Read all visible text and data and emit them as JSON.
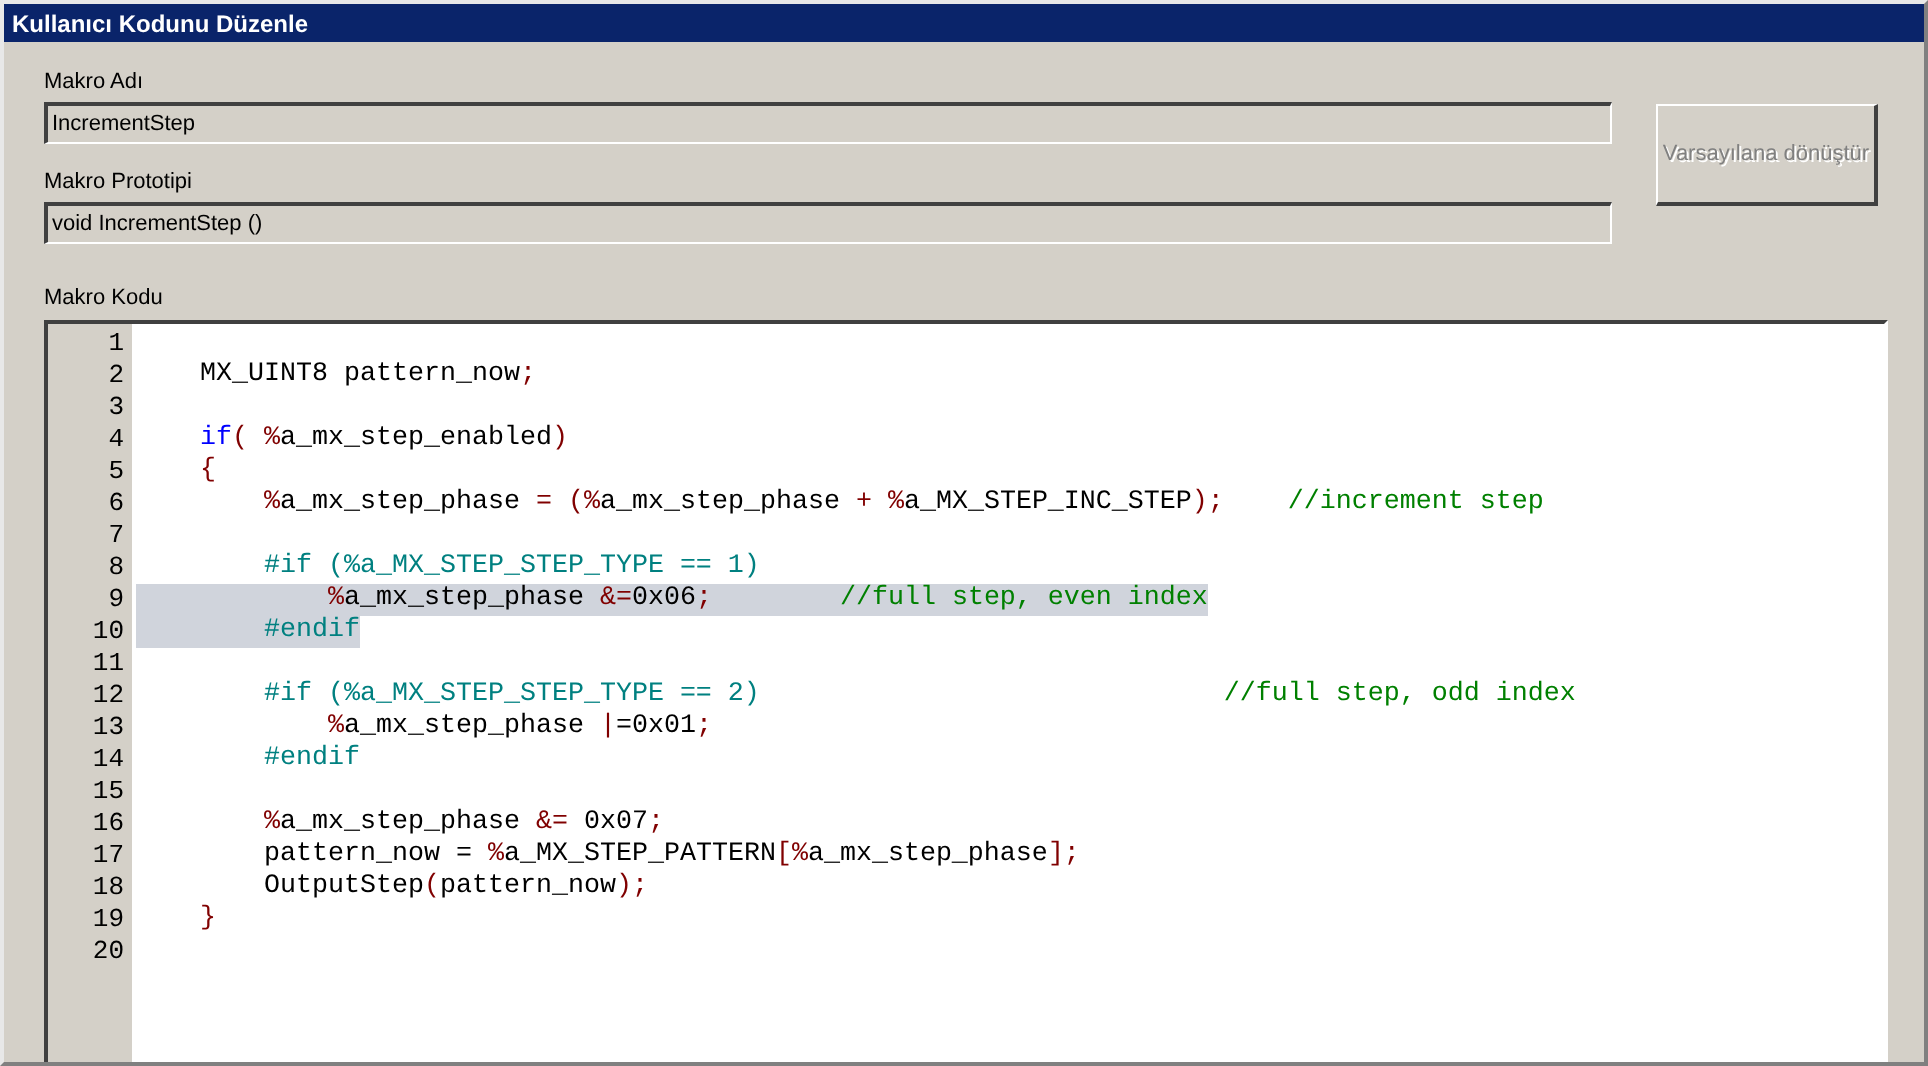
{
  "window": {
    "title": "Kullanıcı Kodunu Düzenle"
  },
  "fields": [
    {
      "label": "Makro Adı",
      "value": "IncrementStep"
    },
    {
      "label": "Makro Prototipi",
      "value": "void IncrementStep ()"
    }
  ],
  "button": {
    "label": "Varsayılana dönüştür",
    "disabled": true
  },
  "code": {
    "label": "Makro Kodu",
    "lines": [
      {
        "number": "1",
        "selected": false
      },
      {
        "number": "2",
        "selected": false,
        "segments": [
          {
            "text": "    MX_UINT8 pattern_now",
            "kind": "plain"
          },
          {
            "text": ";",
            "kind": "operator"
          }
        ]
      },
      {
        "number": "3",
        "selected": false
      },
      {
        "number": "4",
        "selected": false,
        "segments": [
          {
            "text": "    if",
            "kind": "keyword"
          },
          {
            "text": "( %",
            "kind": "operator"
          },
          {
            "text": "a_mx_step_enabled",
            "kind": "plain"
          },
          {
            "text": ")",
            "kind": "operator"
          }
        ]
      },
      {
        "number": "5",
        "selected": false,
        "segments": [
          {
            "text": "    {",
            "kind": "operator"
          }
        ]
      },
      {
        "number": "6",
        "selected": false,
        "segments": [
          {
            "text": "        %",
            "kind": "operator"
          },
          {
            "text": "a_mx_step_phase ",
            "kind": "plain"
          },
          {
            "text": "= (%",
            "kind": "operator"
          },
          {
            "text": "a_mx_step_phase ",
            "kind": "plain"
          },
          {
            "text": "+ %",
            "kind": "operator"
          },
          {
            "text": "a_MX_STEP_INC_STEP",
            "kind": "plain"
          },
          {
            "text": ");",
            "kind": "operator"
          },
          {
            "text": "    //increment step",
            "kind": "comment"
          }
        ]
      },
      {
        "number": "7",
        "selected": false
      },
      {
        "number": "8",
        "selected": false,
        "segments": [
          {
            "text": "        #if (%a_MX_STEP_STEP_TYPE == 1)",
            "kind": "preprocessor"
          }
        ]
      },
      {
        "number": "9",
        "selected": true,
        "segments": [
          {
            "text": "            %",
            "kind": "operator"
          },
          {
            "text": "a_mx_step_phase ",
            "kind": "plain"
          },
          {
            "text": "&=",
            "kind": "operator"
          },
          {
            "text": "0x06",
            "kind": "plain"
          },
          {
            "text": ";",
            "kind": "operator"
          },
          {
            "text": "        //full step, even index",
            "kind": "comment"
          }
        ]
      },
      {
        "number": "10",
        "selected": true,
        "segments": [
          {
            "text": "        #endif",
            "kind": "preprocessor"
          }
        ]
      },
      {
        "number": "11",
        "selected": false
      },
      {
        "number": "12",
        "selected": false,
        "segments": [
          {
            "text": "        #if (%a_MX_STEP_STEP_TYPE == 2)",
            "kind": "preprocessor"
          },
          {
            "text": "                             //full step, odd index",
            "kind": "comment"
          }
        ]
      },
      {
        "number": "13",
        "selected": false,
        "segments": [
          {
            "text": "            %",
            "kind": "operator"
          },
          {
            "text": "a_mx_step_phase ",
            "kind": "plain"
          },
          {
            "text": "|",
            "kind": "operator"
          },
          {
            "text": "=0x01",
            "kind": "plain"
          },
          {
            "text": ";",
            "kind": "operator"
          }
        ]
      },
      {
        "number": "14",
        "selected": false,
        "segments": [
          {
            "text": "        #endif",
            "kind": "preprocessor"
          }
        ]
      },
      {
        "number": "15",
        "selected": false
      },
      {
        "number": "16",
        "selected": false,
        "segments": [
          {
            "text": "        %",
            "kind": "operator"
          },
          {
            "text": "a_mx_step_phase ",
            "kind": "plain"
          },
          {
            "text": "&=",
            "kind": "operator"
          },
          {
            "text": " 0x07",
            "kind": "plain"
          },
          {
            "text": ";",
            "kind": "operator"
          }
        ]
      },
      {
        "number": "17",
        "selected": false,
        "segments": [
          {
            "text": "        pattern_now = ",
            "kind": "plain"
          },
          {
            "text": "%",
            "kind": "operator"
          },
          {
            "text": "a_MX_STEP_PATTERN",
            "kind": "plain"
          },
          {
            "text": "[%",
            "kind": "operator"
          },
          {
            "text": "a_mx_step_phase",
            "kind": "plain"
          },
          {
            "text": "];",
            "kind": "operator"
          }
        ]
      },
      {
        "number": "18",
        "selected": false,
        "segments": [
          {
            "text": "        OutputStep",
            "kind": "plain"
          },
          {
            "text": "(",
            "kind": "operator"
          },
          {
            "text": "pattern_now",
            "kind": "plain"
          },
          {
            "text": ");",
            "kind": "operator"
          }
        ]
      },
      {
        "number": "19",
        "selected": false,
        "segments": [
          {
            "text": "    }",
            "kind": "operator"
          }
        ]
      },
      {
        "number": "20",
        "selected": false
      }
    ]
  }
}
